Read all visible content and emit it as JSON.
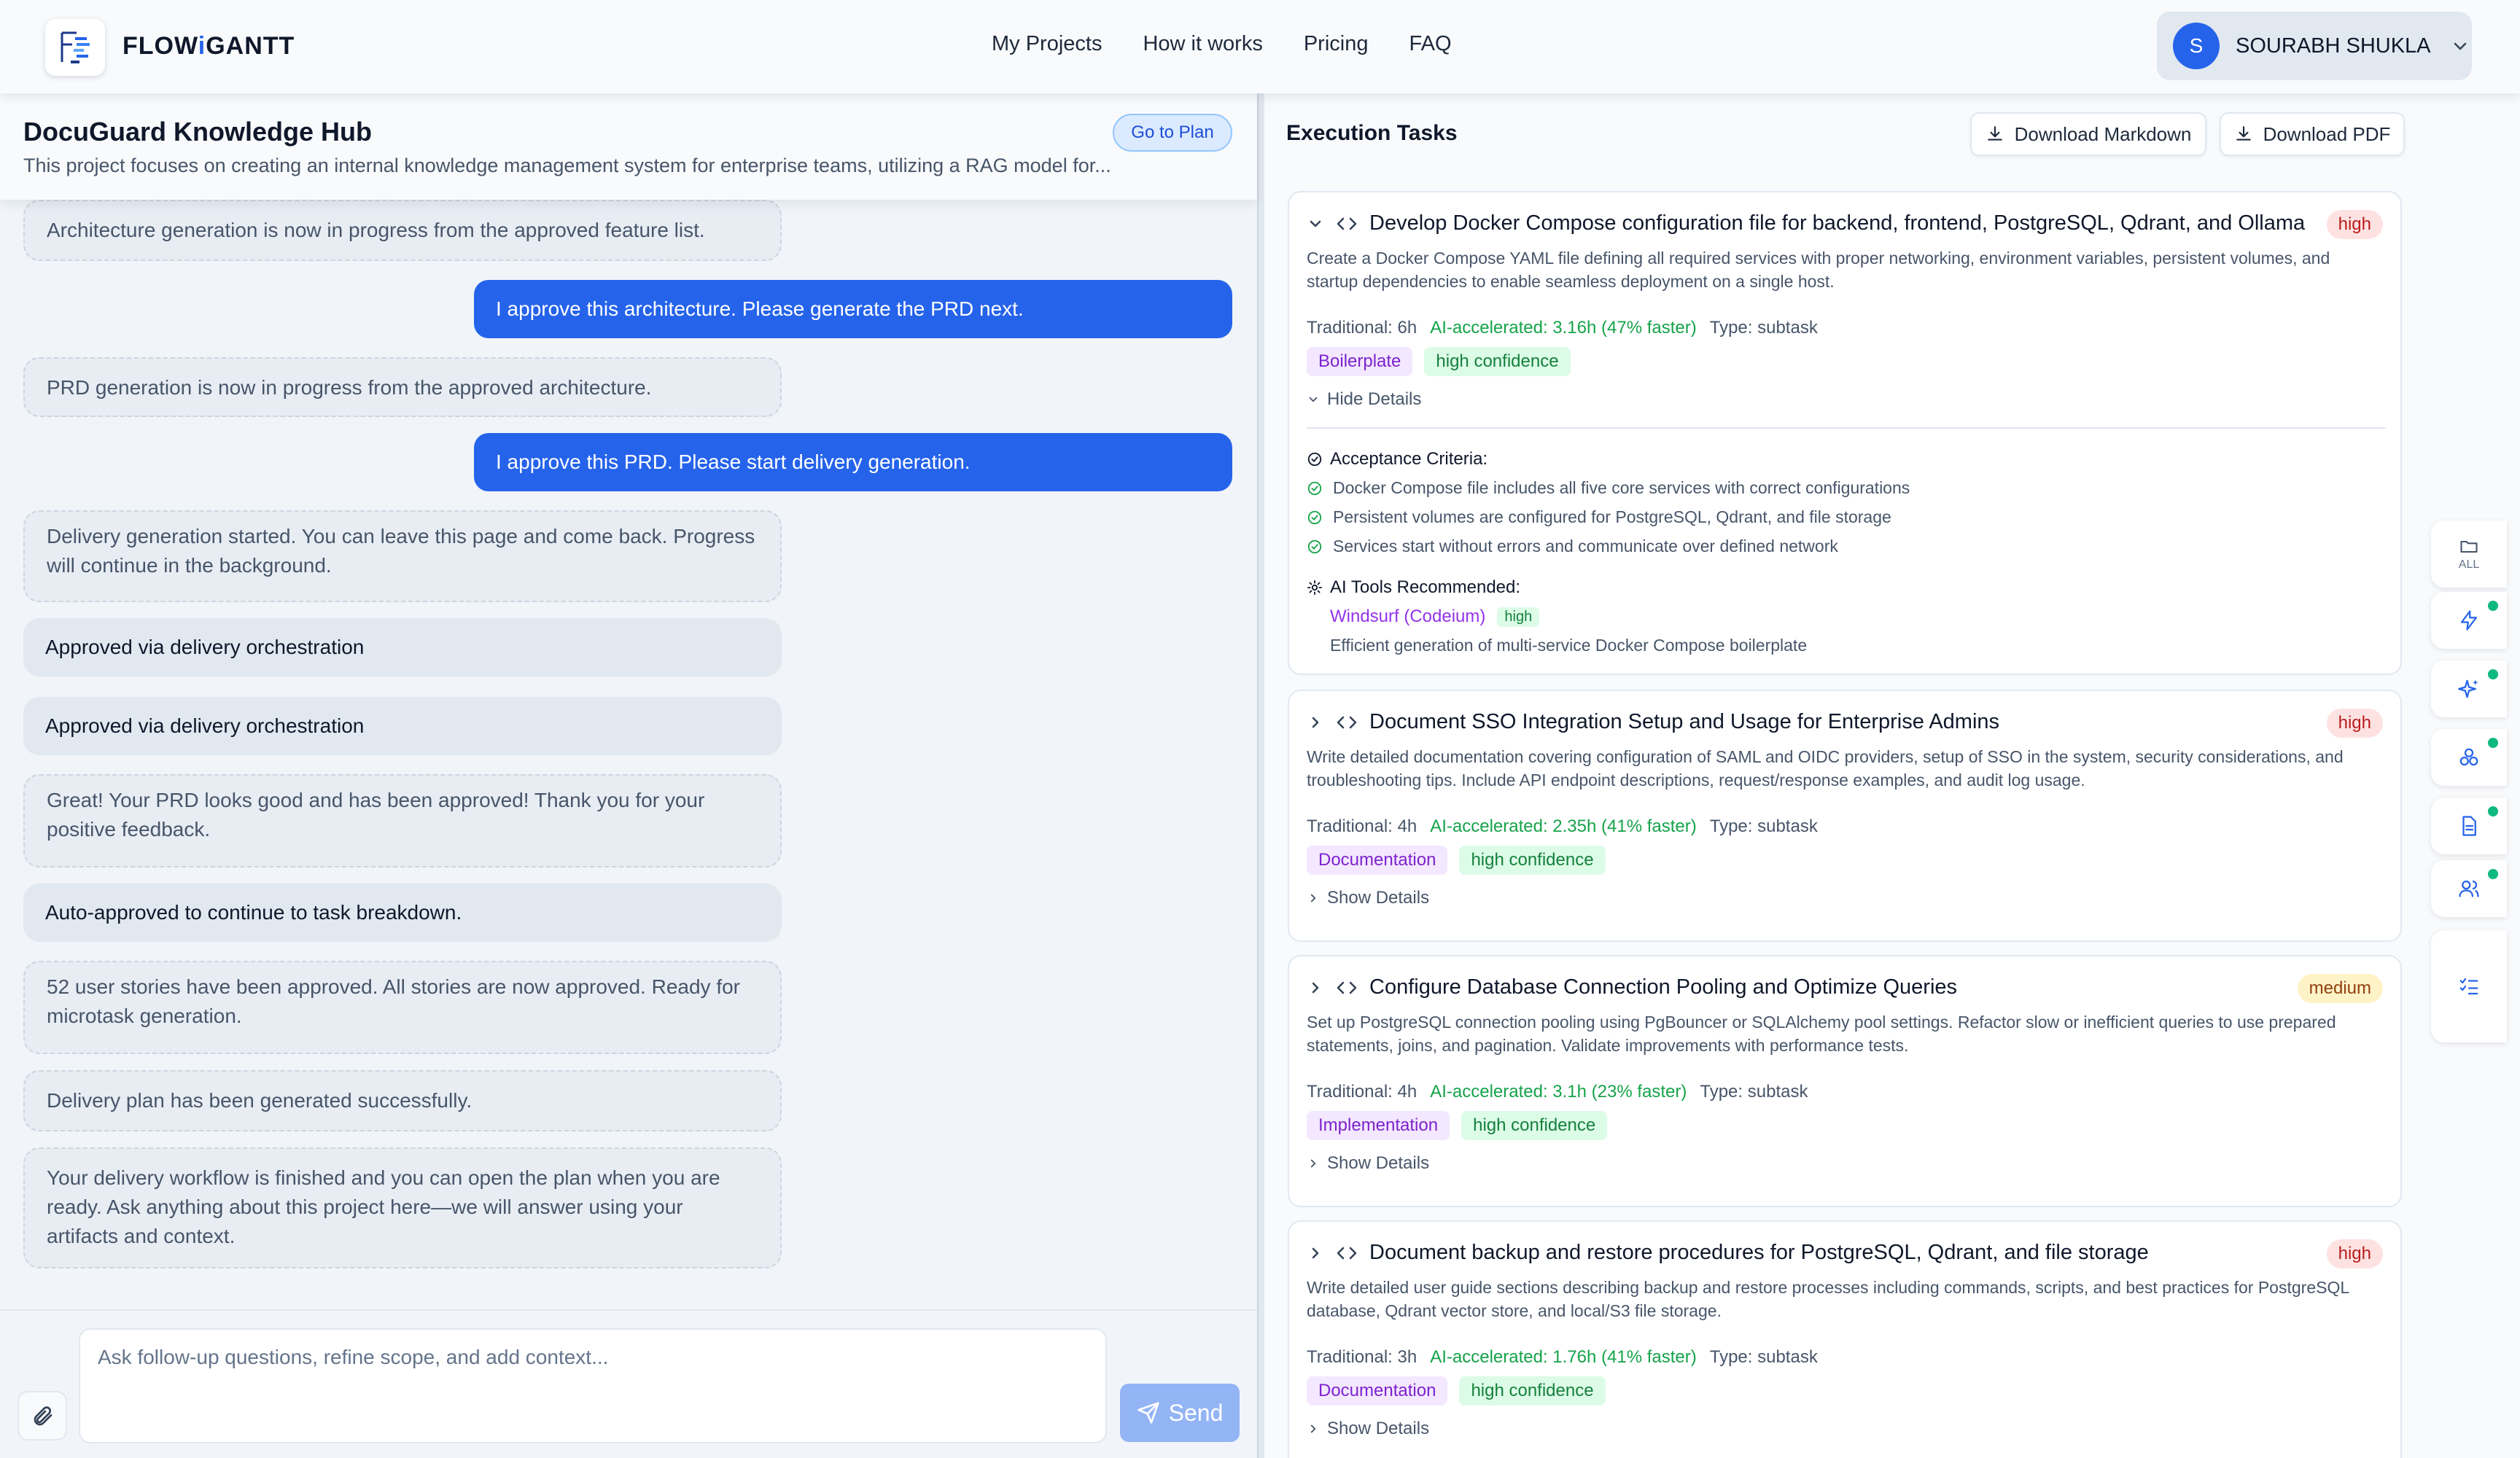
{
  "nav": {
    "brand_prefix": "FLOW",
    "brand_i": "i",
    "brand_suffix": "GANTT",
    "links": [
      "My Projects",
      "How it works",
      "Pricing",
      "FAQ"
    ],
    "user": {
      "initial": "S",
      "name": "SOURABH SHUKLA"
    }
  },
  "project": {
    "title": "DocuGuard Knowledge Hub",
    "description": "This project focuses on creating an internal knowledge management system for enterprise teams, utilizing a RAG model for...",
    "go_to_plan": "Go to Plan"
  },
  "chat": {
    "messages": [
      {
        "role": "system",
        "text": "Architecture generation is now in progress from the approved feature list."
      },
      {
        "role": "user",
        "text": "I approve this architecture. Please generate the PRD next."
      },
      {
        "role": "system",
        "text": "PRD generation is now in progress from the approved architecture."
      },
      {
        "role": "user",
        "text": "I approve this PRD. Please start delivery generation."
      },
      {
        "role": "system",
        "text": "Delivery generation started. You can leave this page and come back. Progress will continue in the background."
      },
      {
        "role": "status",
        "text": "Approved via delivery orchestration"
      },
      {
        "role": "status",
        "text": "Approved via delivery orchestration"
      },
      {
        "role": "system",
        "text": "Great! Your PRD looks good and has been approved! Thank you for your positive feedback."
      },
      {
        "role": "status",
        "text": "Auto-approved to continue to task breakdown."
      },
      {
        "role": "system",
        "text": "52 user stories have been approved. All stories are now approved. Ready for microtask generation."
      },
      {
        "role": "system",
        "text": "Delivery plan has been generated successfully."
      },
      {
        "role": "system",
        "text": "Your delivery workflow is finished and you can open the plan when you are ready. Ask anything about this project here—we will answer using your artifacts and context."
      }
    ],
    "input_placeholder": "Ask follow-up questions, refine scope, and add context...",
    "input_value": "",
    "send_label": "Send"
  },
  "execution": {
    "title": "Execution Tasks",
    "download_markdown": "Download Markdown",
    "download_pdf": "Download PDF",
    "tasks": [
      {
        "title": "Develop Docker Compose configuration file for backend, frontend, PostgreSQL, Qdrant, and Ollama",
        "priority": "high",
        "description": "Create a Docker Compose YAML file defining all required services with proper networking, environment variables, persistent volumes, and startup dependencies to enable seamless deployment on a single host.",
        "traditional": "Traditional: 6h",
        "ai_accelerated": "AI-accelerated: 3.16h (47% faster)",
        "type": "Type: subtask",
        "category": "Boilerplate",
        "confidence": "high confidence",
        "toggle": "Hide Details",
        "expanded": true,
        "acceptance_label": "Acceptance Criteria:",
        "criteria": [
          "Docker Compose file includes all five core services with correct configurations",
          "Persistent volumes are configured for PostgreSQL, Qdrant, and file storage",
          "Services start without errors and communicate over defined network"
        ],
        "tools_label": "AI Tools Recommended:",
        "tool_name": "Windsurf (Codeium)",
        "tool_badge": "high",
        "tool_desc": "Efficient generation of multi-service Docker Compose boilerplate"
      },
      {
        "title": "Document SSO Integration Setup and Usage for Enterprise Admins",
        "priority": "high",
        "description": "Write detailed documentation covering configuration of SAML and OIDC providers, setup of SSO in the system, security considerations, and troubleshooting tips. Include API endpoint descriptions, request/response examples, and audit log usage.",
        "traditional": "Traditional: 4h",
        "ai_accelerated": "AI-accelerated: 2.35h (41% faster)",
        "type": "Type: subtask",
        "category": "Documentation",
        "confidence": "high confidence",
        "toggle": "Show Details",
        "expanded": false
      },
      {
        "title": "Configure Database Connection Pooling and Optimize Queries",
        "priority": "medium",
        "description": "Set up PostgreSQL connection pooling using PgBouncer or SQLAlchemy pool settings. Refactor slow or inefficient queries to use prepared statements, joins, and pagination. Validate improvements with performance tests.",
        "traditional": "Traditional: 4h",
        "ai_accelerated": "AI-accelerated: 3.1h (23% faster)",
        "type": "Type: subtask",
        "category": "Implementation",
        "confidence": "high confidence",
        "toggle": "Show Details",
        "expanded": false
      },
      {
        "title": "Document backup and restore procedures for PostgreSQL, Qdrant, and file storage",
        "priority": "high",
        "description": "Write detailed user guide sections describing backup and restore processes including commands, scripts, and best practices for PostgreSQL database, Qdrant vector store, and local/S3 file storage.",
        "traditional": "Traditional: 3h",
        "ai_accelerated": "AI-accelerated: 1.76h (41% faster)",
        "type": "Type: subtask",
        "category": "Documentation",
        "confidence": "high confidence",
        "toggle": "Show Details",
        "expanded": false
      }
    ]
  },
  "rail": {
    "all_label": "ALL",
    "icons": [
      "folder-icon",
      "lightning-icon",
      "sparkle-icon",
      "cubes-icon",
      "document-icon",
      "users-icon",
      "checklist-icon"
    ],
    "status_color": "#10b981"
  },
  "colors": {
    "accent": "#2563eb",
    "success": "#16a34a",
    "tool": "#9333ea"
  }
}
